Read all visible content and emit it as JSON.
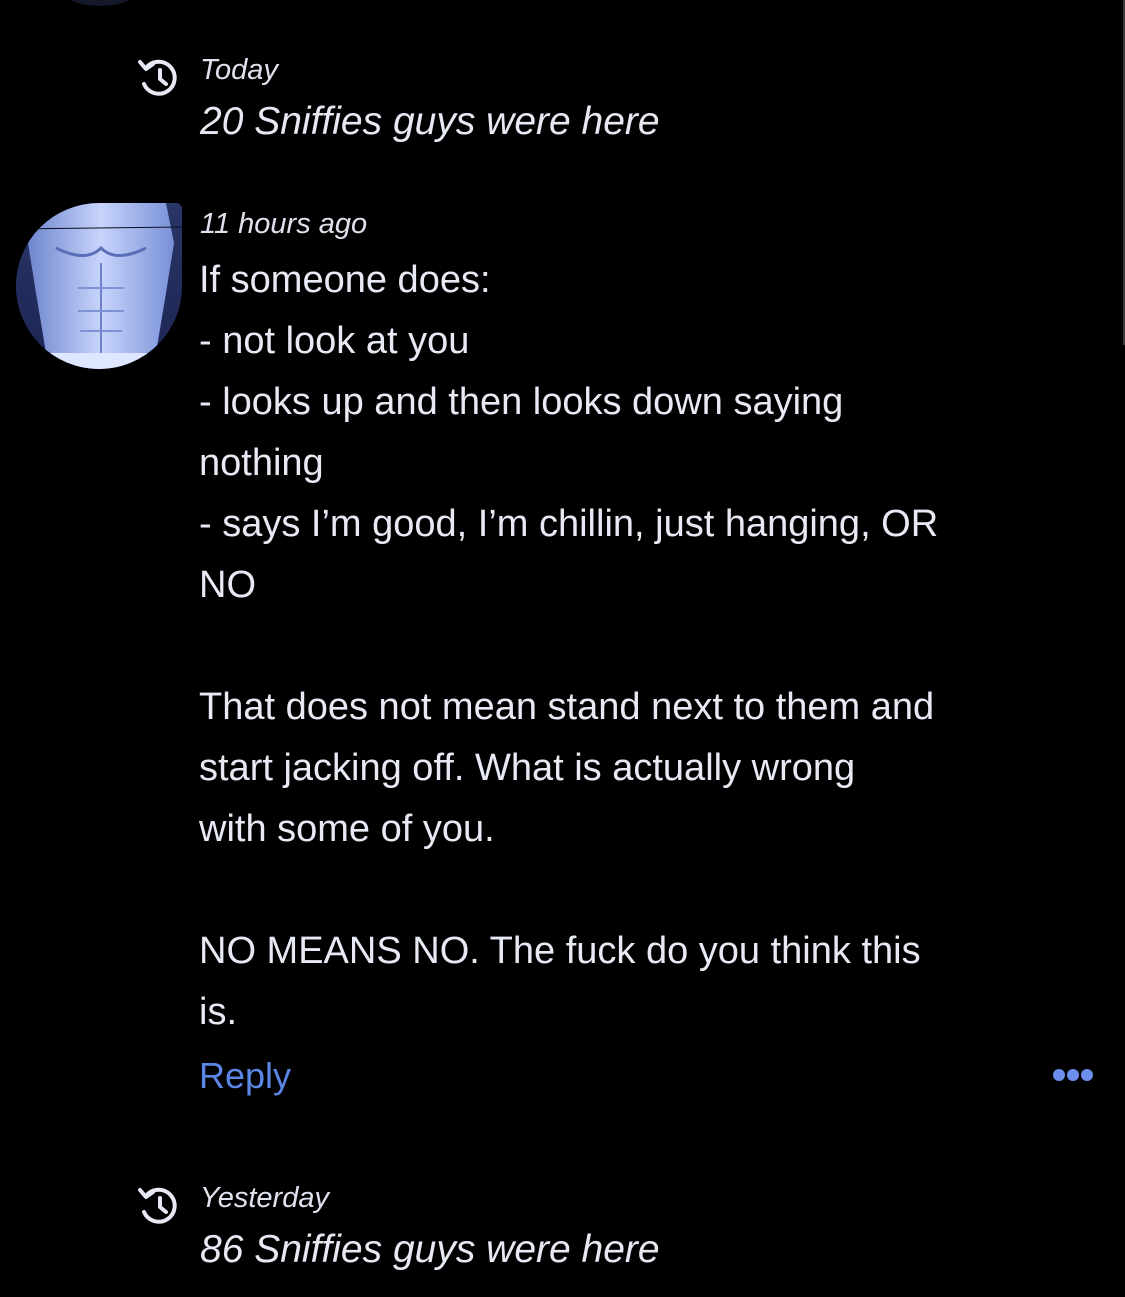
{
  "colors": {
    "background": "#000000",
    "text": "#e7e9f4",
    "link": "#5b86e6",
    "avatar_tint": "#9fb3f0"
  },
  "checkins": [
    {
      "icon": "history-icon",
      "date": "Today",
      "count_text": "20 Sniffies guys were here"
    },
    {
      "icon": "history-icon",
      "date": "Yesterday",
      "count_text": "86 Sniffies guys were here"
    }
  ],
  "comment": {
    "avatar_icon": "avatar",
    "time": "11 hours ago",
    "lines": [
      "If someone does:",
      "- not look at you",
      "- looks up and then looks down saying",
      "nothing",
      "- says I’m good, I’m chillin, just hanging, OR",
      "NO",
      "",
      "That does not mean stand next to them and",
      "start jacking off. What is actually wrong",
      "with some of you.",
      "",
      "NO MEANS NO. The fuck do you think this",
      "is."
    ],
    "reply_label": "Reply",
    "more_icon": "more-options-icon"
  }
}
